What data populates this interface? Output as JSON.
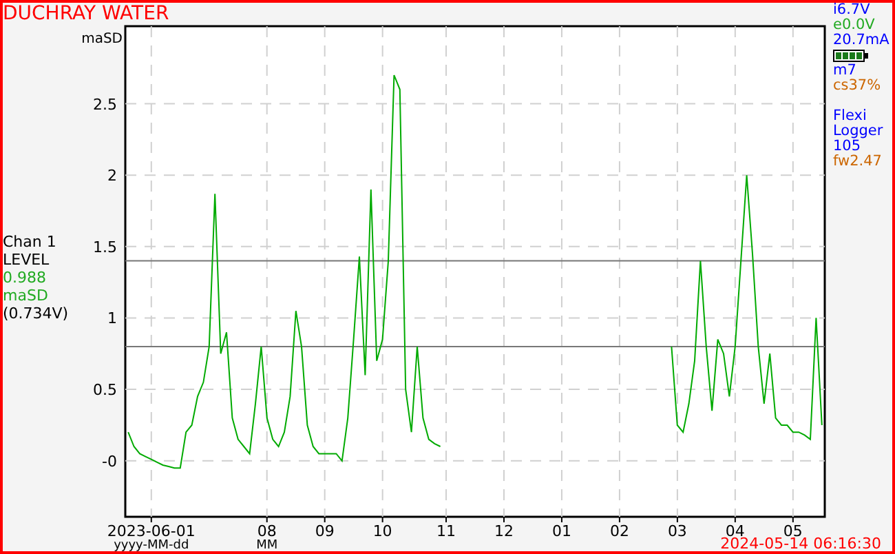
{
  "title": "DUCHRAY WATER",
  "channel": {
    "label": "Chan 1",
    "reading": "0.988",
    "unit": "maSD",
    "voltage": "(0.734V)"
  },
  "status": [
    {
      "kind": "text",
      "text": "i6.7V",
      "color": "#0000ff"
    },
    {
      "kind": "text",
      "text": "e0.0V",
      "color": "#22aa22"
    },
    {
      "kind": "text",
      "text": "20.7mA",
      "color": "#0000ff"
    },
    {
      "kind": "battery"
    },
    {
      "kind": "text",
      "text": "m7",
      "color": "#0000ff"
    },
    {
      "kind": "text",
      "text": "cs37%",
      "color": "#cc6600"
    },
    {
      "kind": "gap"
    },
    {
      "kind": "text",
      "text": "Flexi",
      "color": "#0000ff"
    },
    {
      "kind": "text",
      "text": "Logger",
      "color": "#0000ff"
    },
    {
      "kind": "text",
      "text": "105",
      "color": "#0000ff"
    },
    {
      "kind": "text",
      "text": "fw2.47",
      "color": "#cc6600"
    }
  ],
  "chart_data": {
    "type": "line",
    "ylabel": "maSD",
    "ylim": [
      -0.392,
      3.043
    ],
    "yticks": [
      {
        "value": 0,
        "label": "-0"
      },
      0.5,
      1,
      1.5,
      2,
      2.5
    ],
    "grid": true,
    "ref_lines": [
      {
        "axis": "y",
        "value": 1.4
      },
      {
        "axis": "y",
        "value": 0.8
      }
    ],
    "categories": [
      null,
      null,
      null,
      null,
      "2023-06-01",
      null,
      null,
      null,
      null,
      null,
      null,
      null,
      null,
      null,
      null,
      null,
      null,
      null,
      null,
      null,
      null,
      null,
      null,
      null,
      "08",
      null,
      null,
      null,
      null,
      null,
      null,
      null,
      null,
      null,
      "09",
      null,
      null,
      null,
      null,
      null,
      null,
      null,
      null,
      null,
      "10",
      null,
      null,
      null,
      null,
      null,
      null,
      null,
      null,
      null,
      null,
      "11",
      null,
      null,
      null,
      null,
      null,
      null,
      null,
      null,
      null,
      "12",
      null,
      null,
      null,
      null,
      null,
      null,
      null,
      null,
      null,
      "01",
      null,
      null,
      null,
      null,
      null,
      null,
      null,
      null,
      null,
      "02",
      null,
      null,
      null,
      null,
      null,
      null,
      null,
      null,
      null,
      "03",
      null,
      null,
      null,
      null,
      null,
      null,
      null,
      null,
      null,
      "04",
      null,
      null,
      null,
      null,
      null,
      null,
      null,
      null,
      null,
      "05",
      null,
      null,
      null,
      null,
      null
    ],
    "series": [
      {
        "name": "LEVEL",
        "color": "#00aa00",
        "values": [
          0.2,
          0.1,
          0.05,
          0.03,
          0.01,
          -0.01,
          -0.03,
          -0.04,
          -0.05,
          -0.05,
          0.2,
          0.25,
          0.45,
          0.55,
          0.8,
          1.87,
          0.75,
          0.9,
          0.3,
          0.15,
          0.1,
          0.05,
          0.4,
          0.8,
          0.3,
          0.15,
          0.1,
          0.2,
          0.45,
          1.05,
          0.8,
          0.25,
          0.1,
          0.05,
          0.05,
          0.05,
          0.05,
          0.0,
          0.3,
          0.85,
          1.43,
          0.6,
          1.9,
          0.7,
          0.85,
          1.4,
          2.7,
          2.6,
          0.5,
          0.2,
          0.8,
          0.3,
          0.15,
          0.12,
          0.1,
          null,
          null,
          null,
          null,
          null,
          null,
          null,
          null,
          null,
          null,
          null,
          null,
          null,
          null,
          null,
          null,
          null,
          null,
          null,
          null,
          null,
          null,
          null,
          null,
          null,
          null,
          null,
          null,
          null,
          null,
          null,
          null,
          null,
          null,
          null,
          null,
          null,
          null,
          null,
          0.8,
          0.25,
          0.2,
          0.4,
          0.7,
          1.4,
          0.8,
          0.35,
          0.85,
          0.75,
          0.45,
          0.8,
          1.4,
          2.0,
          1.45,
          0.8,
          0.4,
          0.75,
          0.3,
          0.25,
          0.25,
          0.2,
          0.2,
          0.18,
          0.15,
          1.0,
          0.25
        ]
      }
    ]
  },
  "x_formats": [
    {
      "label": "yyyy-MM-dd"
    },
    {
      "label": "MM"
    }
  ],
  "timestamp": "2024-05-14 06:16:30"
}
